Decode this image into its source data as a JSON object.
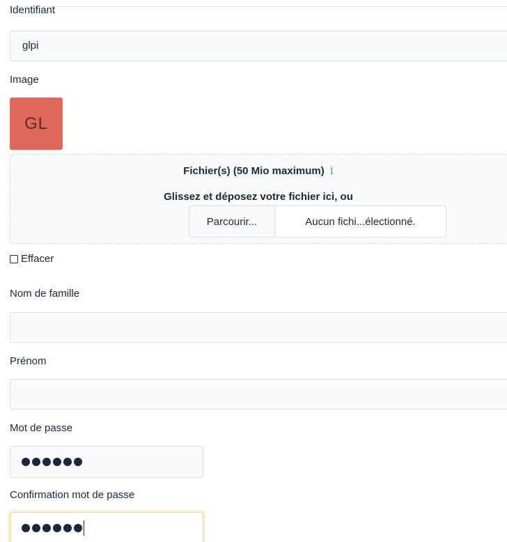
{
  "form": {
    "login": {
      "label": "Identifiant",
      "value": "glpi"
    },
    "picture": {
      "label": "Image",
      "avatar_initials": "GL",
      "avatar_color": "#e0675b",
      "dropzone": {
        "title": "Fichier(s) (50 Mio maximum)",
        "info_icon": "i",
        "instruction": "Glissez et déposez votre fichier ici, ou",
        "browse_label": "Parcourir...",
        "status_text": "Aucun fichi...électionné."
      },
      "clear_label": "Effacer",
      "clear_checked": false
    },
    "last_name": {
      "label": "Nom de famille",
      "value": ""
    },
    "first_name": {
      "label": "Prénom",
      "value": ""
    },
    "password": {
      "label": "Mot de passe",
      "masked_length": 6
    },
    "password_confirm": {
      "label": "Confirmation mot de passe",
      "masked_length": 6,
      "focused": true
    }
  }
}
